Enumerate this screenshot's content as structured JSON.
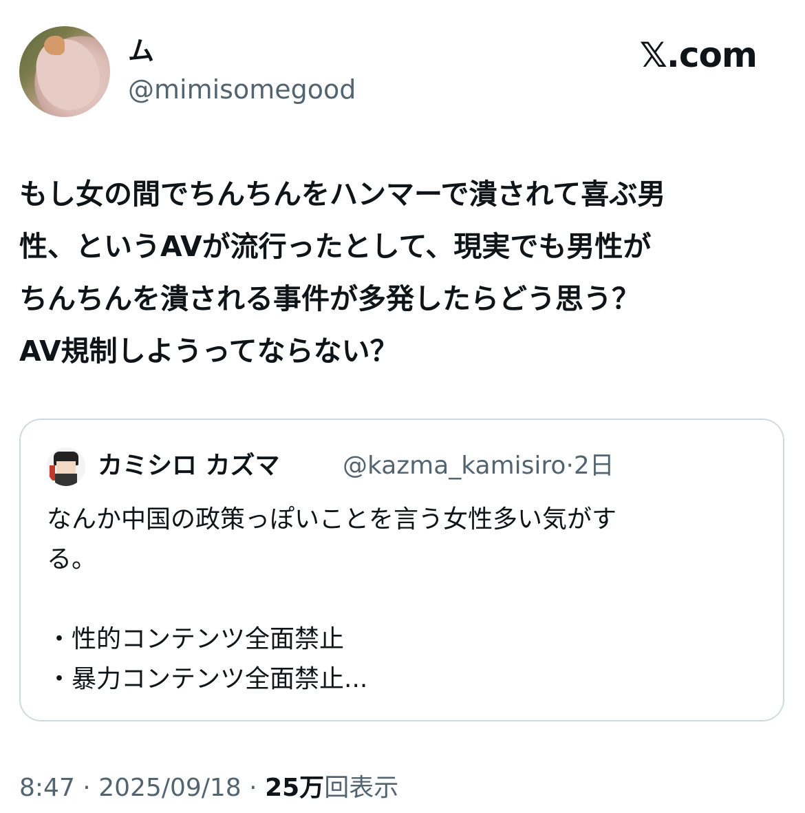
{
  "author": {
    "display_name": "ム",
    "handle": "@mimisomegood"
  },
  "brand": {
    "logo_text": ".com",
    "logo_mark": "𝕏"
  },
  "tweet": {
    "text": "もし女の間でちんちんをハンマーで潰されて喜ぶ男\n性、というAVが流行ったとして、現実でも男性が\nちんちんを潰される事件が多発したらどう思う？\nAV規制しようってならない？"
  },
  "quote": {
    "display_name": "カミシロ カズマ",
    "handle": "@kazma_kamisiro",
    "separator": "·",
    "age": "2日",
    "text": "なんか中国の政策っぽいことを言う女性多い気がす\nる。\n\n・性的コンテンツ全面禁止\n・暴力コンテンツ全面禁止..."
  },
  "footer": {
    "time": "8:47",
    "sep1": "·",
    "date": "2025/09/18",
    "sep2": "·",
    "views_number": "25",
    "views_unit": "万",
    "views_label": "回表示"
  },
  "colors": {
    "text_primary": "#0f1419",
    "text_secondary": "#536471",
    "border": "#cfd9de",
    "background": "#ffffff"
  }
}
